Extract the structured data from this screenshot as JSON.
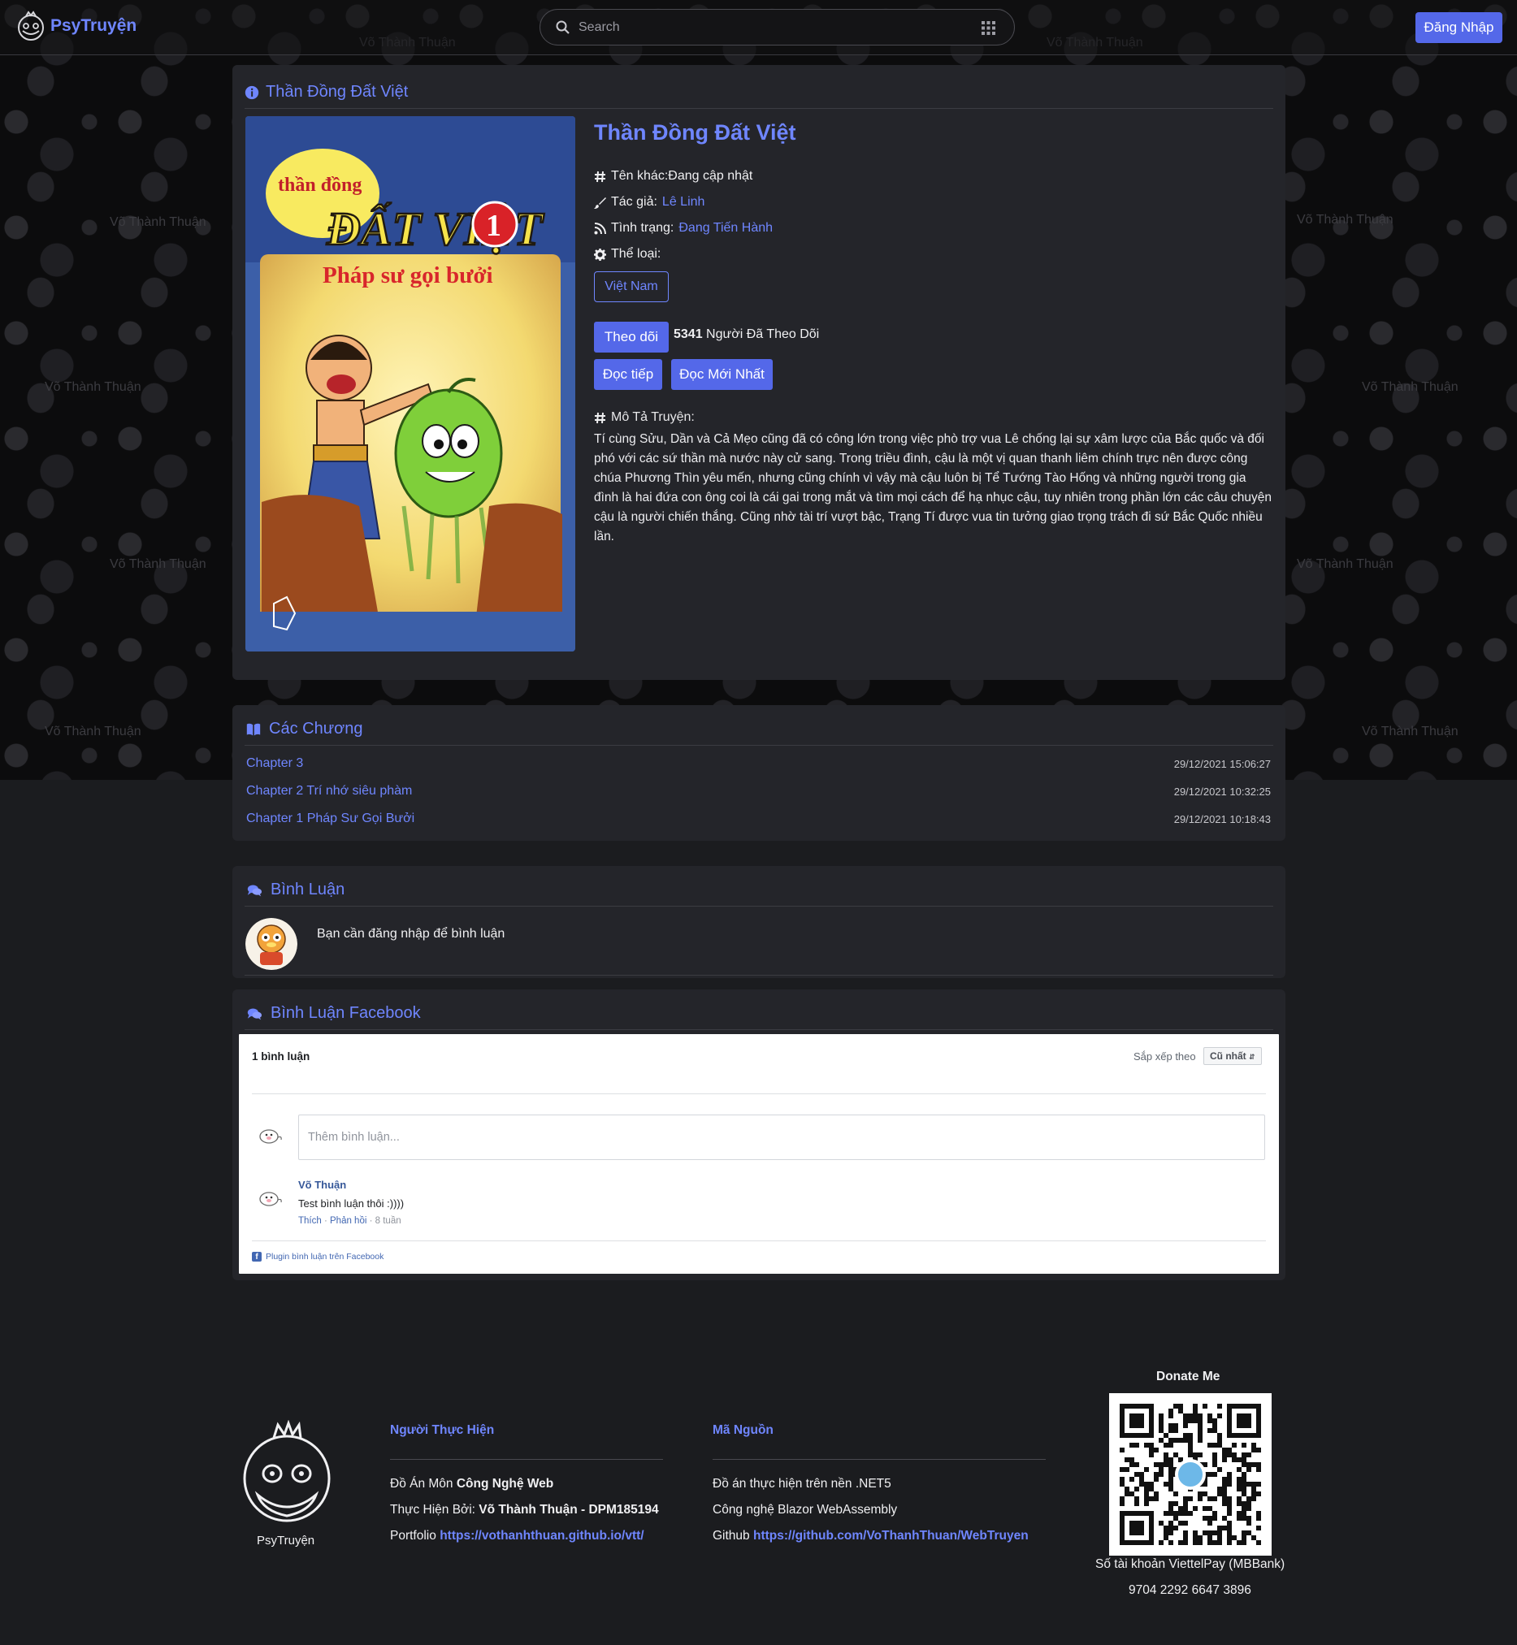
{
  "navbar": {
    "brand": "PsyTruyện",
    "search_placeholder": "Search",
    "login_label": "Đăng Nhập"
  },
  "watermark_text": "Võ Thành Thuận",
  "info": {
    "header": "Thần Đồng Đất Việt",
    "cover_text": {
      "series_small": "thần đồng",
      "series_big": "ĐẤT VIỆT",
      "volume": "1",
      "subtitle": "Pháp sư gọi bưởi"
    },
    "title": "Thần Đồng Đất Việt",
    "other_name_label": "Tên khác:",
    "other_name_value": "Đang cập nhật",
    "author_label": "Tác giả:",
    "author_value": "Lê Linh",
    "status_label": "Tình trạng:",
    "status_value": "Đang Tiến Hành",
    "genre_label": "Thể loại:",
    "genre_tag": "Việt Nam",
    "follow_button": "Theo dõi",
    "follow_count": "5341",
    "follow_suffix": "Người Đã Theo Dõi",
    "continue_button": "Đọc tiếp",
    "latest_button": "Đọc Mới Nhất",
    "description_label": "Mô Tả Truyện:",
    "description": "Tí cùng Sửu, Dần và Cả Mẹo cũng đã có công lớn trong việc phò trợ vua Lê chống lại sự xâm lược của Bắc quốc và đối phó với các sứ thần mà nước này cử sang. Trong triều đình, cậu là một vị quan thanh liêm chính trực nên được công chúa Phương Thìn yêu mến, nhưng cũng chính vì vậy mà cậu luôn bị Tể Tướng Tào Hống và những người trong gia đình là hai đứa con ông coi là cái gai trong mắt và tìm mọi cách để hạ nhục cậu, tuy nhiên trong phần lớn các câu chuyện cậu là người chiến thắng. Cũng nhờ tài trí vượt bậc, Trạng Tí được vua tin tưởng giao trọng trách đi sứ Bắc Quốc nhiều lần."
  },
  "chapters": {
    "header": "Các Chương",
    "items": [
      {
        "title": "Chapter 3",
        "date": "29/12/2021 15:06:27"
      },
      {
        "title": "Chapter 2 Trí nhớ siêu phàm",
        "date": "29/12/2021 10:32:25"
      },
      {
        "title": "Chapter 1 Pháp Sư Gọi Bưởi",
        "date": "29/12/2021 10:18:43"
      }
    ]
  },
  "comments": {
    "header": "Bình Luận",
    "login_note": "Bạn cần đăng nhập để bình luận"
  },
  "fb": {
    "header": "Bình Luận Facebook",
    "count": "1 bình luận",
    "sort_label": "Sắp xếp theo",
    "sort_value": "Cũ nhất",
    "input_placeholder": "Thêm bình luận...",
    "comment_author": "Võ Thuận",
    "comment_text": "Test bình luận thôi :))))",
    "like": "Thích",
    "reply": "Phản hồi",
    "age": "8 tuần",
    "plugin": "Plugin bình luận trên Facebook"
  },
  "footer": {
    "brand": "PsyTruyện",
    "col1_title": "Người Thực Hiện",
    "col1_l1_prefix": "Đồ Án Môn",
    "col1_l1_bold": "Công Nghệ Web",
    "col1_l2_prefix": "Thực Hiện Bởi:",
    "col1_l2_bold": "Võ Thành Thuận - DPM185194",
    "col1_l3_prefix": "Portfolio",
    "col1_l3_link": "https://vothanhthuan.github.io/vtt/",
    "col2_title": "Mã Nguồn",
    "col2_l1": "Đồ án thực hiện trên nền .NET5",
    "col2_l2": "Công nghệ Blazor WebAssembly",
    "col2_l3_prefix": "Github",
    "col2_l3_link": "https://github.com/VoThanhThuan/WebTruyen",
    "donate_title": "Donate Me",
    "bank_label": "Số tài khoản ViettelPay (MBBank)",
    "bank_number": "9704 2292 6647 3896"
  },
  "colors": {
    "accent": "#6f86ff",
    "primary_button": "#5468e9",
    "card_bg": "#24252a",
    "page_bg": "#1b1c1f"
  },
  "icons": [
    "psyduck-logo-icon",
    "search-icon",
    "apps-grid-icon",
    "info-circle-icon",
    "hashtag-icon",
    "brush-icon",
    "rss-icon",
    "gear-icon",
    "book-open-icon",
    "comments-icon",
    "facebook-icon"
  ]
}
